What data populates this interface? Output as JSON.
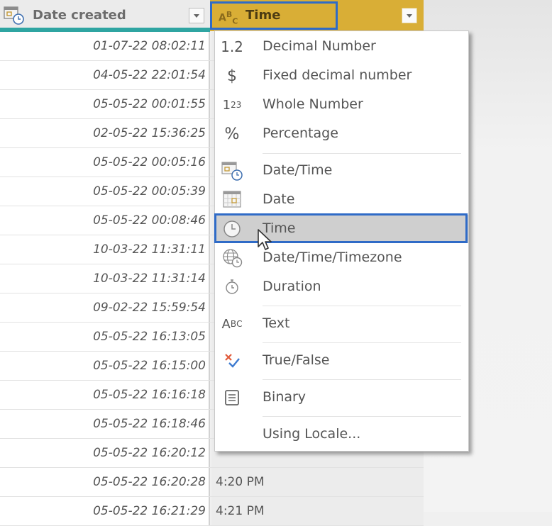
{
  "columns": {
    "date_created": {
      "label": "Date created",
      "icon": "datetime-type-icon"
    },
    "time": {
      "label": "Time",
      "icon": "text-type-icon",
      "type_glyph": "ABC"
    }
  },
  "rows": [
    {
      "date": "01-07-22 08:02:11",
      "time": ""
    },
    {
      "date": "04-05-22 22:01:54",
      "time": ""
    },
    {
      "date": "05-05-22 00:01:55",
      "time": ""
    },
    {
      "date": "02-05-22 15:36:25",
      "time": ""
    },
    {
      "date": "05-05-22 00:05:16",
      "time": ""
    },
    {
      "date": "05-05-22 00:05:39",
      "time": ""
    },
    {
      "date": "05-05-22 00:08:46",
      "time": ""
    },
    {
      "date": "10-03-22 11:31:11",
      "time": ""
    },
    {
      "date": "10-03-22 11:31:14",
      "time": ""
    },
    {
      "date": "09-02-22 15:59:54",
      "time": ""
    },
    {
      "date": "05-05-22 16:13:05",
      "time": ""
    },
    {
      "date": "05-05-22 16:15:00",
      "time": ""
    },
    {
      "date": "05-05-22 16:16:18",
      "time": ""
    },
    {
      "date": "05-05-22 16:18:46",
      "time": ""
    },
    {
      "date": "05-05-22 16:20:12",
      "time": ""
    },
    {
      "date": "05-05-22 16:20:28",
      "time": "4:20 PM"
    },
    {
      "date": "05-05-22 16:21:29",
      "time": "4:21 PM"
    }
  ],
  "type_menu": {
    "items": [
      {
        "label": "Decimal Number",
        "icon": "decimal-icon",
        "glyph": "1.2"
      },
      {
        "label": "Fixed decimal number",
        "icon": "currency-icon",
        "glyph": "$"
      },
      {
        "label": "Whole Number",
        "icon": "whole-number-icon",
        "glyph": "123"
      },
      {
        "label": "Percentage",
        "icon": "percent-icon",
        "glyph": "%"
      },
      {
        "label": "Date/Time",
        "icon": "datetime-icon"
      },
      {
        "label": "Date",
        "icon": "calendar-icon"
      },
      {
        "label": "Time",
        "icon": "clock-icon",
        "hovered": true
      },
      {
        "label": "Date/Time/Timezone",
        "icon": "globe-clock-icon"
      },
      {
        "label": "Duration",
        "icon": "stopwatch-icon"
      },
      {
        "label": "Text",
        "icon": "text-abc-icon",
        "glyph": "ABC"
      },
      {
        "label": "True/False",
        "icon": "true-false-icon"
      },
      {
        "label": "Binary",
        "icon": "binary-icon"
      },
      {
        "label": "Using Locale...",
        "icon": ""
      }
    ]
  },
  "colors": {
    "accent_blue": "#2f6bc7",
    "selected_column": "#d9ae36",
    "teal_quality_bar": "#2fa5a2"
  }
}
